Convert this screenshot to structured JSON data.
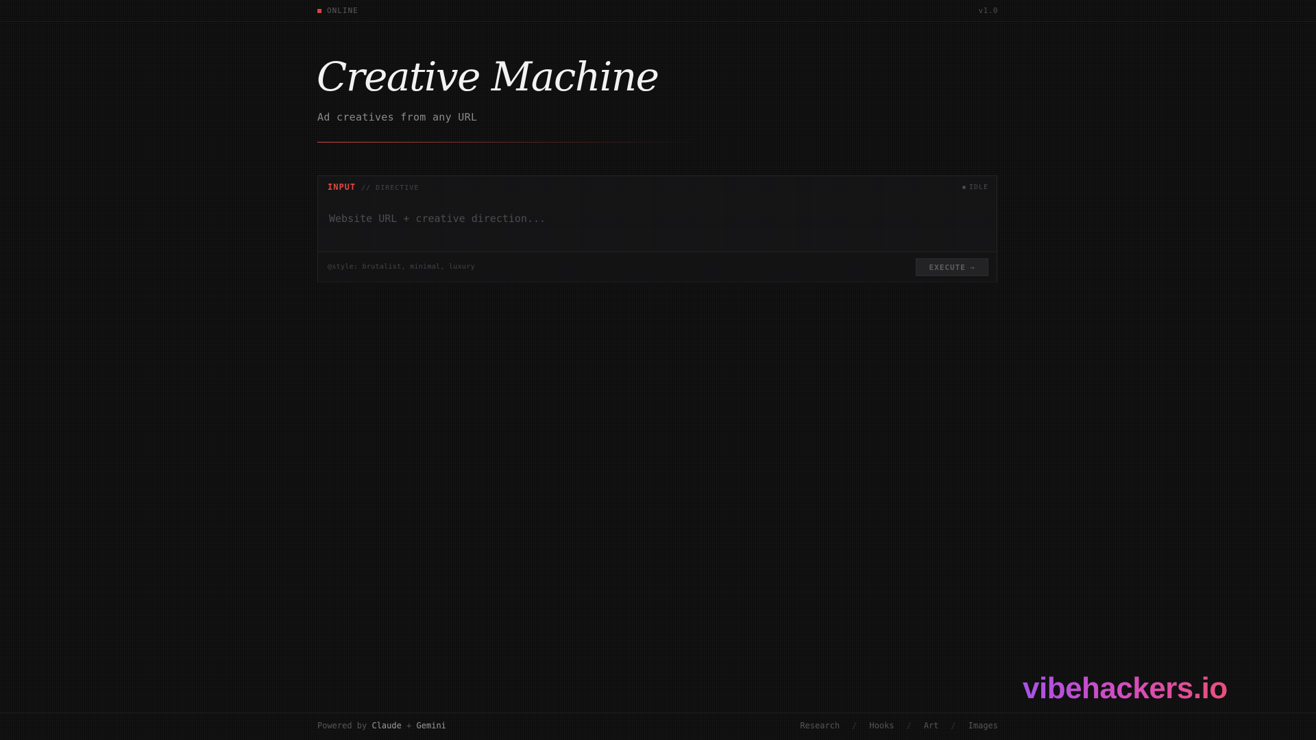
{
  "status": {
    "label": "ONLINE",
    "dot_color": "#d6473d"
  },
  "version": "v1.0",
  "header": {
    "title": "Creative Machine",
    "subtitle": "Ad creatives from any URL"
  },
  "panel": {
    "label": "INPUT",
    "separator": "// DIRECTIVE",
    "state": "IDLE",
    "input_placeholder": "Website URL + creative direction...",
    "input_value": "",
    "style_hint": "@style: brutalist, minimal, luxury",
    "execute_label": "EXECUTE",
    "execute_arrow": "→"
  },
  "footer": {
    "powered_prefix": "Powered by",
    "brand_1": "Claude",
    "brand_join": "+",
    "brand_2": "Gemini",
    "nav": [
      "Research",
      "Hooks",
      "Art",
      "Images"
    ],
    "nav_separator": "/"
  },
  "watermark": "vibehackers.io",
  "colors": {
    "accent": "#d6473d",
    "background": "#0d0d0e",
    "title": "#f2f2f2"
  }
}
